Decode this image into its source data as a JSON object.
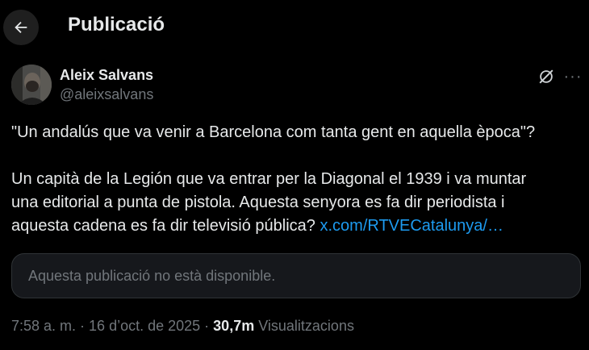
{
  "header": {
    "title": "Publicació",
    "back_icon": "arrow-left-icon"
  },
  "author": {
    "name": "Aleix Salvans",
    "handle": "@aleixsalvans"
  },
  "actions": {
    "grok_icon": "grok-icon",
    "more_icon": "more-horizontal-icon",
    "more_label": "···"
  },
  "post": {
    "line1": "\"Un andalús que va venir a Barcelona com tanta gent en aquella època\"?",
    "line2": "Un capità de la Legión que va entrar per la Diagonal el 1939 i va muntar",
    "line3": "una editorial a punta de pistola. Aquesta senyora es fa dir periodista i",
    "line4_text": "aquesta cadena es fa dir televisió pública? ",
    "link": "x.com/RTVECatalunya/…"
  },
  "quote_card": {
    "text": "Aquesta publicació no està disponible."
  },
  "meta": {
    "time": "7:58 a. m.",
    "sep1": " · ",
    "date": "16 d’oct. de 2025",
    "sep2": " · ",
    "views": "30,7m",
    "views_label": " Visualitzacions"
  },
  "colors": {
    "background": "#000000",
    "text": "#e7e9ea",
    "muted": "#71767b",
    "link": "#1d9bf0"
  }
}
